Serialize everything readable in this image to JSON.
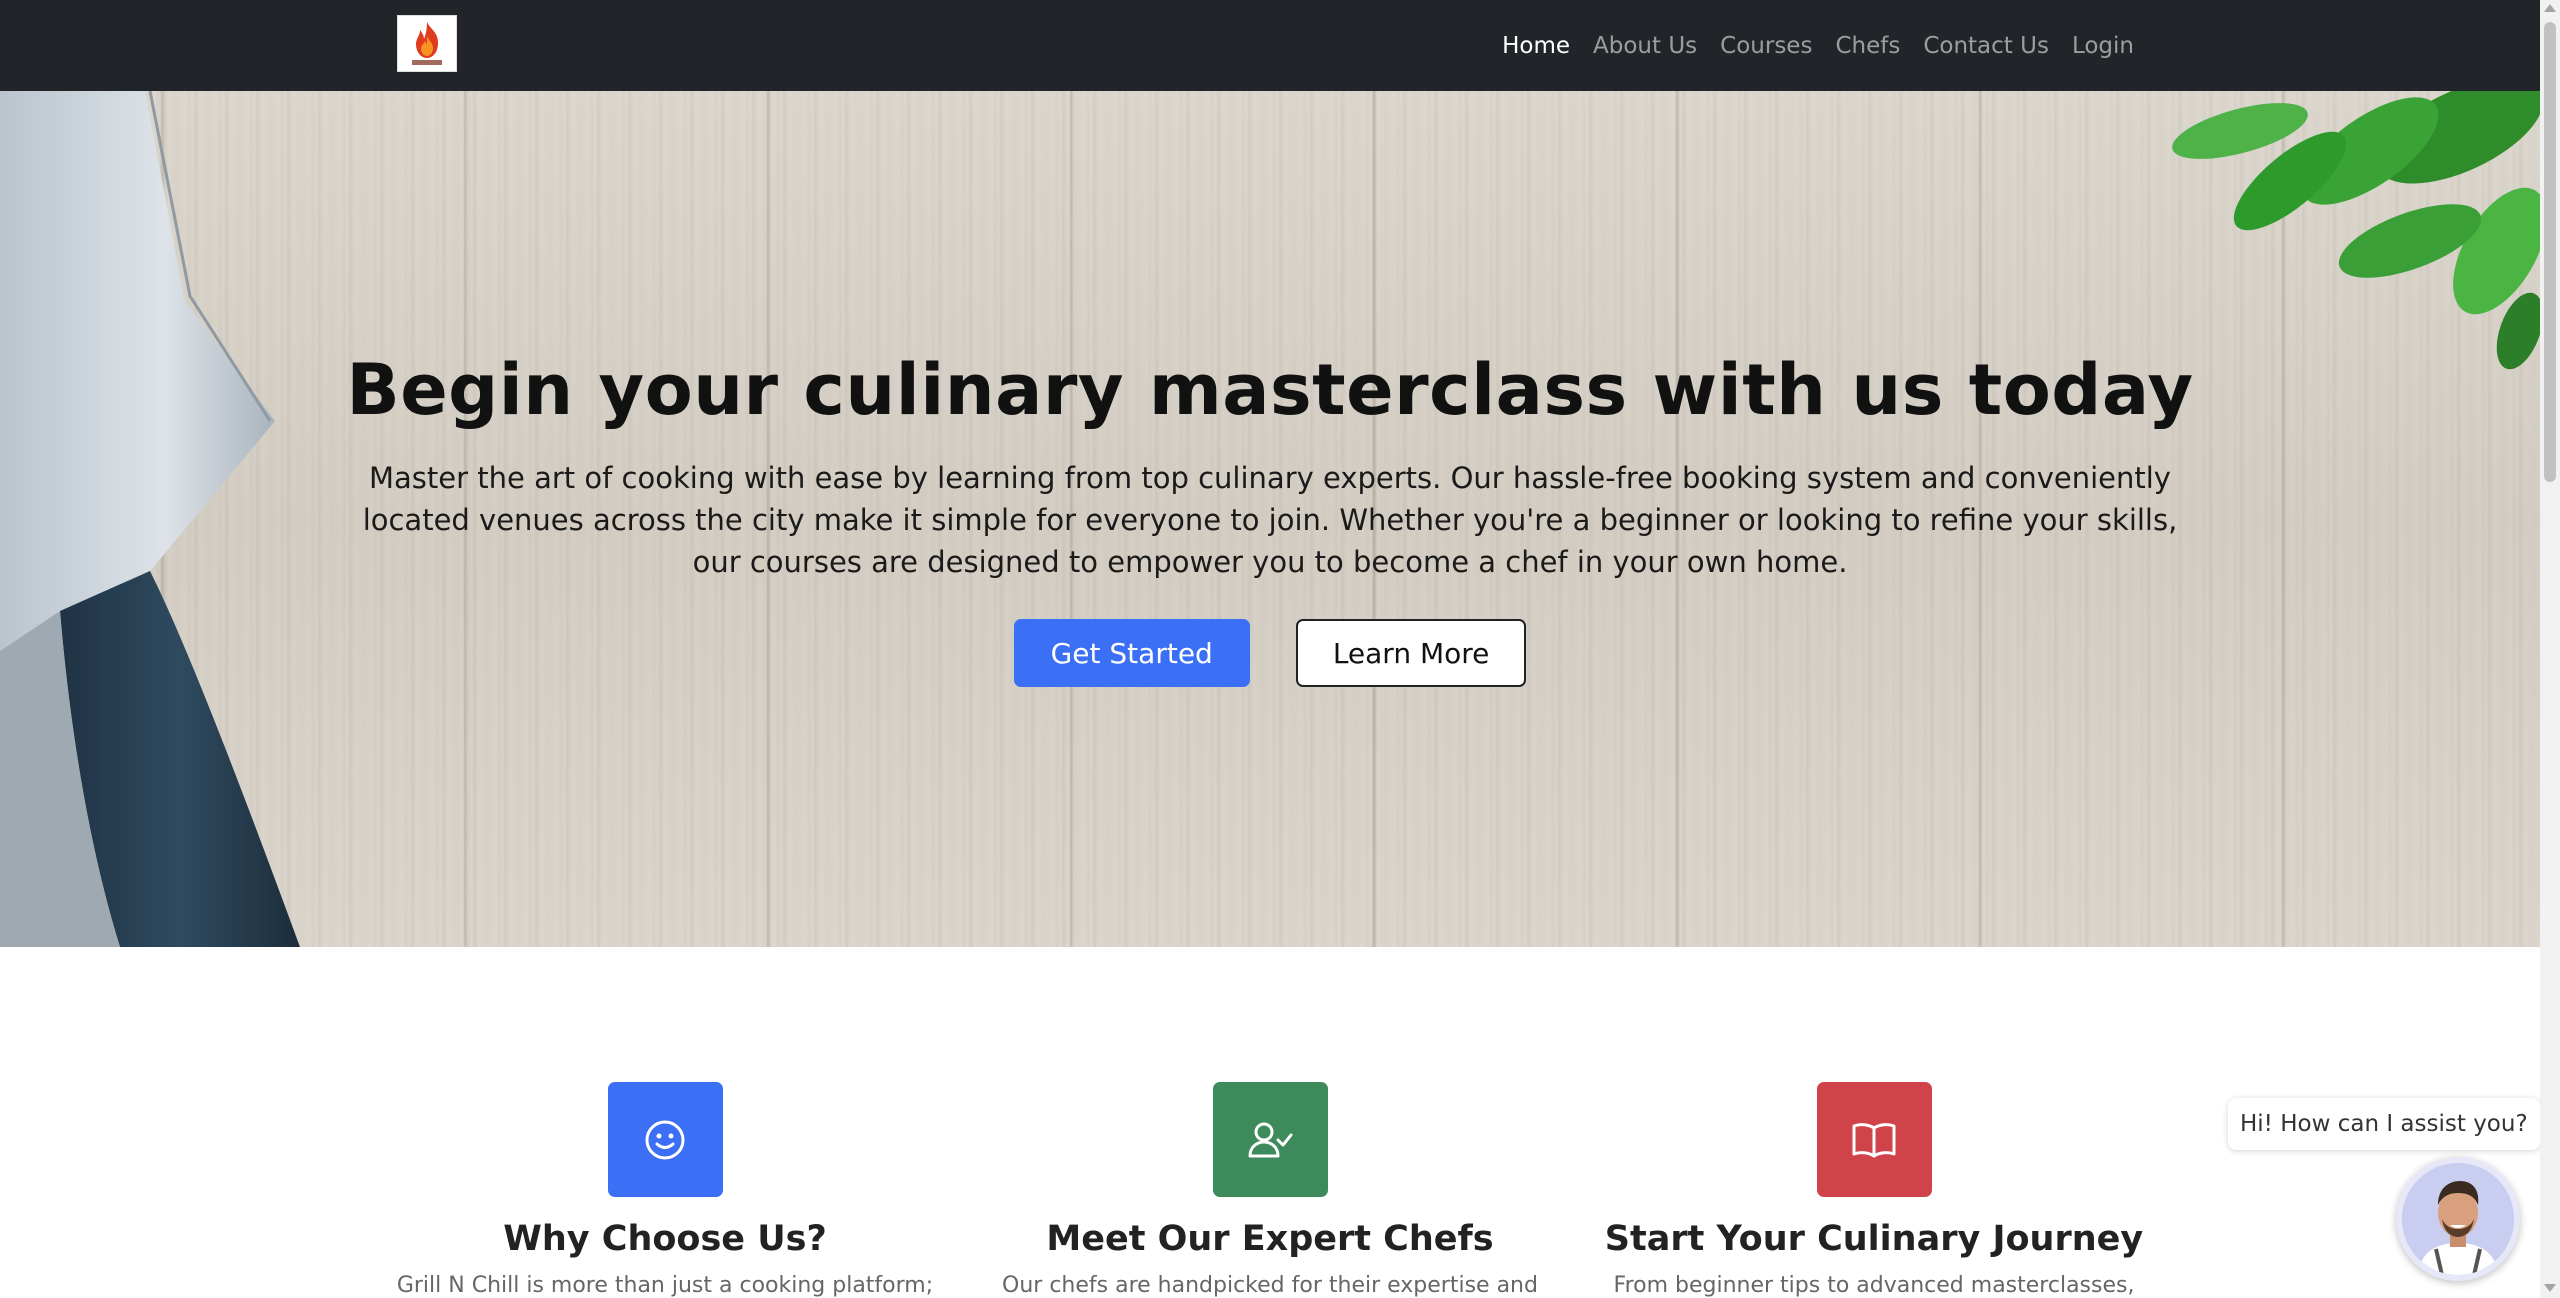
{
  "nav": {
    "logo_alt": "Grill N Chill",
    "items": [
      {
        "label": "Home"
      },
      {
        "label": "About Us"
      },
      {
        "label": "Courses"
      },
      {
        "label": "Chefs"
      },
      {
        "label": "Contact Us"
      },
      {
        "label": "Login"
      }
    ],
    "active_item": "Home"
  },
  "hero": {
    "title": "Begin your culinary masterclass with us today",
    "text": "Master the art of cooking with ease by learning from top culinary experts. Our hassle-free booking system and conveniently located venues across the city make it simple for everyone to join. Whether you're a beginner or looking to refine your skills, our courses are designed to empower you to become a chef in your own home.",
    "primary_button": "Get Started",
    "secondary_button": "Learn More"
  },
  "features": [
    {
      "icon": "smile-icon",
      "color": "#3b6ff5",
      "title": "Why Choose Us?",
      "text": "Grill N Chill is more than just a cooking platform;"
    },
    {
      "icon": "user-check-icon",
      "color": "#3d8a5a",
      "title": "Meet Our Expert Chefs",
      "text": "Our chefs are handpicked for their expertise and"
    },
    {
      "icon": "book-icon",
      "color": "#d1434b",
      "title": "Start Your Culinary Journey",
      "text": "From beginner tips to advanced masterclasses,"
    }
  ],
  "chat": {
    "bubble_text": "Hi! How can I assist you?",
    "avatar": "chef-avatar-icon"
  },
  "colors": {
    "navbar": "#212529",
    "primary": "#3b6ff5"
  }
}
